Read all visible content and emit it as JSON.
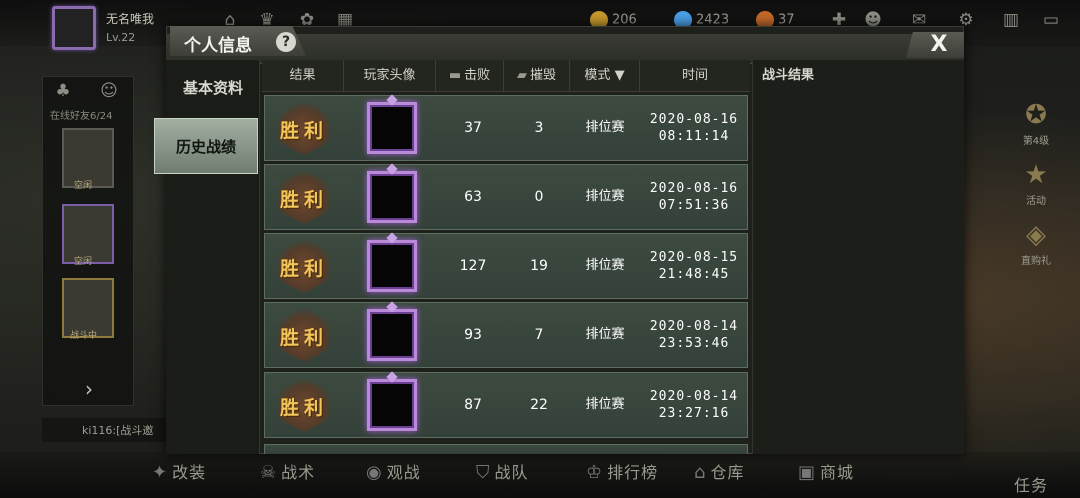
{
  "hud": {
    "player_name": "无名唯我",
    "player_level": "Lv.22",
    "currencies": [
      {
        "value": "206",
        "color": "#c79a2c"
      },
      {
        "value": "2423",
        "color": "#4aa0e8"
      },
      {
        "value": "37",
        "color": "#c4692a"
      }
    ]
  },
  "friends": {
    "online_label": "在线好友6/24",
    "tags": [
      "空闲",
      "空闲",
      "战斗中"
    ],
    "chat_text": "ki116:[战斗邀"
  },
  "side_icons": [
    {
      "label": "第4级",
      "icon": "star-badge-icon"
    },
    {
      "label": "活动",
      "icon": "star-icon"
    },
    {
      "label": "直购礼",
      "icon": "gift-card-icon"
    }
  ],
  "bottom_nav": [
    "改装",
    "战术",
    "观战",
    "战队",
    "排行榜",
    "仓库",
    "商城",
    "任务"
  ],
  "modal": {
    "title": "个人信息",
    "help": "?",
    "close": "X",
    "tabs": [
      "基本资料",
      "历史战绩"
    ],
    "active_tab": 1
  },
  "table": {
    "headers": {
      "result": "结果",
      "avatar": "玩家头像",
      "kills": "击败",
      "destroys": "摧毁",
      "mode": "模式",
      "time": "时间"
    },
    "rows": [
      {
        "result": "胜利",
        "kills": "37",
        "destroys": "3",
        "mode": "排位赛",
        "date": "2020-08-16",
        "time": "08:11:14"
      },
      {
        "result": "胜利",
        "kills": "63",
        "destroys": "0",
        "mode": "排位赛",
        "date": "2020-08-16",
        "time": "07:51:36"
      },
      {
        "result": "胜利",
        "kills": "127",
        "destroys": "19",
        "mode": "排位赛",
        "date": "2020-08-15",
        "time": "21:48:45"
      },
      {
        "result": "胜利",
        "kills": "93",
        "destroys": "7",
        "mode": "排位赛",
        "date": "2020-08-14",
        "time": "23:53:46"
      },
      {
        "result": "胜利",
        "kills": "87",
        "destroys": "22",
        "mode": "排位赛",
        "date": "2020-08-14",
        "time": "23:27:16"
      }
    ]
  },
  "battle_result": {
    "title": "战斗结果"
  }
}
